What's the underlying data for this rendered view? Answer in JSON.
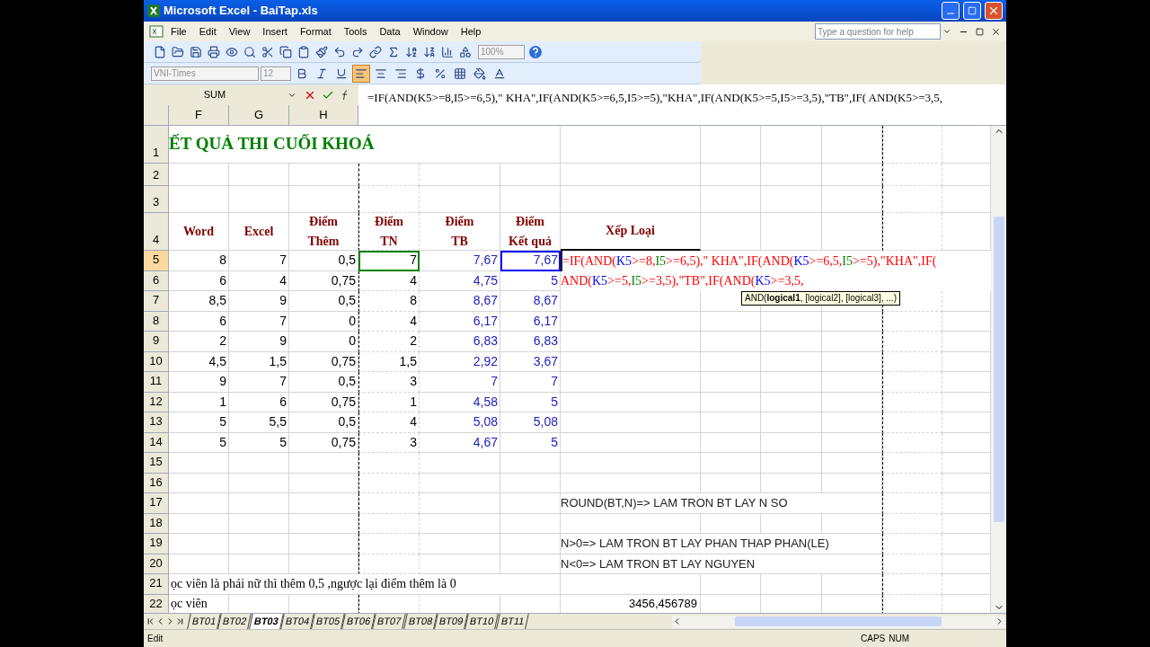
{
  "window": {
    "title": "Microsoft Excel - BaiTap.xls"
  },
  "menu": [
    "File",
    "Edit",
    "View",
    "Insert",
    "Format",
    "Tools",
    "Data",
    "Window",
    "Help"
  ],
  "help_box": {
    "placeholder": "Type a question for help"
  },
  "toolbar": {
    "zoom": "100%",
    "font": "VNI-Times",
    "size": "12",
    "align_left_active": true
  },
  "formula_bar": {
    "name_box": "SUM",
    "formula": "=IF(AND(K5>=8,I5>=6,5),\" KHA\",IF(AND(K5>=6,5,I5>=5),\"KHA\",IF(AND(K5>=5,I5>=3,5),\"TB\",IF( AND(K5>=3,5,"
  },
  "column_headers": [
    "F",
    "G",
    "H"
  ],
  "sheet": {
    "title": "ẾT QUẢ THI CUỐI KHOÁ",
    "headers": [
      "Word",
      "Excel",
      "Điểm\nThêm",
      "Điểm\nTN",
      "Điểm\nTB",
      "Điểm\nKết quả",
      "Xếp Loại"
    ],
    "rows": [
      {
        "number": "1",
        "selected": false
      },
      {
        "number": "2",
        "selected": false
      },
      {
        "number": "3",
        "selected": false
      },
      {
        "number": "4",
        "selected": false
      },
      {
        "number": "5",
        "selected": true,
        "values": [
          {
            "text": "8"
          },
          {
            "text": "7"
          },
          {
            "text": "0,5"
          },
          {
            "text": "7",
            "color": "#008000"
          },
          {
            "text": "7,67"
          },
          {
            "text": "7,67",
            "color": "#0000ff"
          }
        ]
      },
      {
        "number": "6",
        "selected": false,
        "values": [
          {
            "text": "6"
          },
          {
            "text": "4"
          },
          {
            "text": "0,75"
          },
          {
            "text": "4"
          },
          {
            "text": "4,75"
          },
          {
            "text": "5"
          }
        ]
      },
      {
        "number": "7",
        "selected": false,
        "values": [
          {
            "text": "8,5"
          },
          {
            "text": "9"
          },
          {
            "text": "0,5"
          },
          {
            "text": "8"
          },
          {
            "text": "8,67"
          },
          {
            "text": "8,67"
          }
        ]
      },
      {
        "number": "8",
        "selected": false,
        "values": [
          {
            "text": "6"
          },
          {
            "text": "7"
          },
          {
            "text": "0"
          },
          {
            "text": "4"
          },
          {
            "text": "6,17"
          },
          {
            "text": "6,17"
          }
        ]
      },
      {
        "number": "9",
        "selected": false,
        "values": [
          {
            "text": "2"
          },
          {
            "text": "9"
          },
          {
            "text": "0"
          },
          {
            "text": "2"
          },
          {
            "text": "6,83"
          },
          {
            "text": "6,83"
          }
        ]
      },
      {
        "number": "10",
        "selected": false,
        "values": [
          {
            "text": "4,5"
          },
          {
            "text": "1,5"
          },
          {
            "text": "0,75"
          },
          {
            "text": "1,5"
          },
          {
            "text": "2,92"
          },
          {
            "text": "3,67"
          }
        ]
      },
      {
        "number": "11",
        "selected": false,
        "values": [
          {
            "text": "9"
          },
          {
            "text": "7"
          },
          {
            "text": "0,5"
          },
          {
            "text": "3"
          },
          {
            "text": "7"
          },
          {
            "text": "7"
          }
        ]
      },
      {
        "number": "12",
        "selected": false,
        "values": [
          {
            "text": "1"
          },
          {
            "text": "6"
          },
          {
            "text": "0,75"
          },
          {
            "text": "1"
          },
          {
            "text": "4,58"
          },
          {
            "text": "5"
          }
        ]
      },
      {
        "number": "13",
        "selected": false,
        "values": [
          {
            "text": "5"
          },
          {
            "text": "5,5"
          },
          {
            "text": "0,5"
          },
          {
            "text": "4"
          },
          {
            "text": "5,08"
          },
          {
            "text": "5,08"
          }
        ]
      },
      {
        "number": "14",
        "selected": false,
        "values": [
          {
            "text": "5"
          },
          {
            "text": "5"
          },
          {
            "text": "0,75"
          },
          {
            "text": "3"
          },
          {
            "text": "4,67"
          },
          {
            "text": "5"
          }
        ]
      },
      {
        "number": "15",
        "selected": false
      },
      {
        "number": "16",
        "selected": false
      },
      {
        "number": "17",
        "selected": false,
        "note": "ROUND(BT,N)=> LAM TRON BT LAY N SO"
      },
      {
        "number": "18",
        "selected": false
      },
      {
        "number": "19",
        "selected": false,
        "note": "N>0=> LAM TRON BT LAY PHAN THAP PHAN(LE)"
      },
      {
        "number": "20",
        "selected": false,
        "note": "N<0=> LAM TRON BT LAY NGUYEN"
      },
      {
        "number": "21",
        "selected": false,
        "left_text": "ọc viên là  phái nữ thì thêm 0,5 ,ngược lại điểm thêm là 0"
      },
      {
        "number": "22",
        "selected": false,
        "left_text": "ọc viên",
        "number_value": "3456,456789"
      }
    ],
    "editing_formula": [
      [
        {
          "text": "=IF(AND(",
          "color": "#ff0000"
        },
        {
          "text": "K5",
          "color": "#0000ff"
        },
        {
          "text": ">=8,",
          "color": "#ff0000"
        },
        {
          "text": "I5",
          "color": "#008000"
        },
        {
          "text": ">=6,5),\" KHA\",IF(AND(",
          "color": "#ff0000"
        },
        {
          "text": "K5",
          "color": "#0000ff"
        },
        {
          "text": ">=6,5,",
          "color": "#ff0000"
        },
        {
          "text": "I5",
          "color": "#008000"
        },
        {
          "text": ">=5),\"KHA\",IF(",
          "color": "#ff0000"
        }
      ],
      [
        {
          "text": "AND(",
          "color": "#ff0000"
        },
        {
          "text": "K5",
          "color": "#0000ff"
        },
        {
          "text": ">=5,",
          "color": "#ff0000"
        },
        {
          "text": "I5",
          "color": "#008000"
        },
        {
          "text": ">=3,5),\"TB\",IF(AND(",
          "color": "#ff0000"
        },
        {
          "text": "K5",
          "color": "#0000ff"
        },
        {
          "text": ">=3,5,",
          "color": "#ff0000"
        }
      ]
    ],
    "tooltip": "AND(**logical1**, [logical2], [logical3], ...)"
  },
  "sheet_tabs": [
    {
      "label": "BT01",
      "selected": false
    },
    {
      "label": "BT02",
      "selected": false
    },
    {
      "label": "BT03",
      "selected": true
    },
    {
      "label": "BT04",
      "selected": false
    },
    {
      "label": "BT05",
      "selected": false
    },
    {
      "label": "BT06",
      "selected": false
    },
    {
      "label": "BT07",
      "selected": false
    },
    {
      "label": "BT08",
      "selected": false
    },
    {
      "label": "BT09",
      "selected": false
    },
    {
      "label": "BT10",
      "selected": false
    },
    {
      "label": "BT11",
      "selected": false
    }
  ],
  "status_bar": {
    "mode": "Edit",
    "indicators": [
      "CAPS",
      "NUM"
    ]
  }
}
